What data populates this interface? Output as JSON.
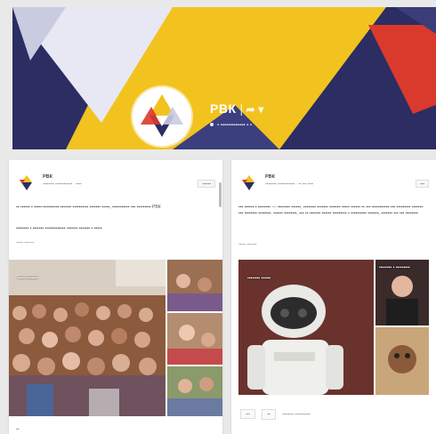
{
  "colors": {
    "cover_navy": "#2b2d63",
    "cover_yellow": "#f2c31f",
    "cover_red": "#d93a2b",
    "cover_light": "#e7e8f4"
  },
  "profile": {
    "name": "РВК",
    "separator": "|",
    "followers": "▪ ▪▪▪▪▪▪▪▪▪▪▪▪▪ ▪ ▪"
  },
  "posts": [
    {
      "author": "РВК",
      "meta": "▪▪▪▪▪▪▪▪ ▪▪▪▪▪▪▪▪▪▪▪▪ · ▪▪▪▪",
      "follow_label": "▪▪▪▪▪▪",
      "text_1": "▪▪ ▪▪▪▪▪▪ ▪ ▪▪▪▪▪-▪▪▪▪▪▪▪▪▪▪ ▪▪▪▪▪▪▪ ▪▪▪▪▪▪▪▪▪▪ ▪▪▪▪▪▪▪ ▪▪▪▪▪, ▪▪▪▪▪▪▪▪▪▪▪ ▪▪▪ ▪▪▪▪▪▪▪▪▪ РВК",
      "text_2": "▪▪▪▪▪▪▪▪ ▪ ▪▪▪▪▪▪▪ ▪▪▪▪▪▪▪▪▪▪▪▪▪ ▪▪▪▪▪▪▪ ▪▪▪▪▪▪▪ ▪ ▪▪▪▪▪",
      "more": "▪▪▪▪▪ ▪▪▪▪▪▪▪",
      "photo_caption": "▪▪▪▪▪ ▪▪▪▪▪▪▪"
    },
    {
      "author": "РВК",
      "meta": "▪▪▪▪▪▪▪▪ ▪▪▪▪▪▪▪▪▪▪▪▪ · ▪▪ ▪▪▪ ▪▪▪▪",
      "follow_label": "▪▪▪",
      "text_1": "▪▪▪ ▪▪▪▪▪▪ ▪ ▪▪▪▪▪▪▪▪ — ▪▪▪▪▪▪▪▪ ▪▪▪▪▪▪, ▪▪▪▪▪▪▪▪ ▪▪▪▪▪▪▪ ▪▪▪▪▪▪▪ ▪▪▪▪▪ ▪▪▪▪▪▪ ▪▪ ▪▪▪ ▪▪▪▪▪▪▪▪▪▪▪ ▪▪▪ ▪▪▪▪▪▪▪▪▪ ▪▪▪▪▪▪▪ ▪▪▪ ▪▪▪▪▪▪▪▪ ▪▪▪▪▪▪▪▪. ▪▪▪▪▪▪ ▪▪▪▪▪▪▪▪, ▪▪▪ ▪▪ ▪▪▪▪▪▪▪ ▪▪▪▪▪▪ ▪▪▪▪▪▪▪▪▪ ▪ ▪▪▪▪▪▪▪▪▪▪ ▪▪▪▪▪▪▪, ▪▪▪▪▪▪▪ ▪▪▪ ▪▪▪ ▪▪▪▪▪▪▪▪",
      "more": "▪▪▪▪▪ ▪▪▪▪▪▪▪",
      "photo_caption": "▪▪▪▪▪▪▪▪ ▪▪▪▪▪▪",
      "photo_caption_2": "▪▪▪▪▪▪▪▪ ▪ ▪▪▪▪▪▪▪▪▪",
      "reply_count": "▪▪▪",
      "comment_placeholder": "▪▪▪▪▪▪▪▪ ▪▪▪▪▪▪▪▪▪▪▪"
    }
  ]
}
